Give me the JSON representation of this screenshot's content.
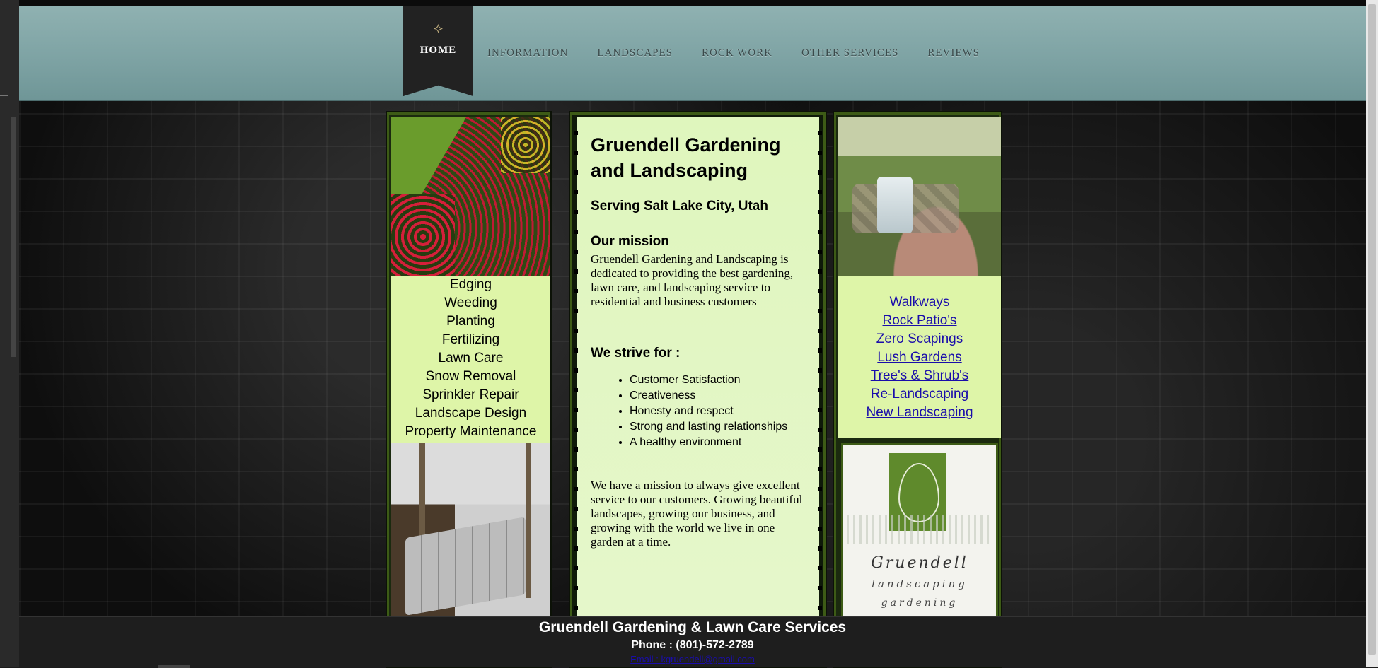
{
  "nav": {
    "flourish": "⟡",
    "items": [
      "HOME",
      "INFORMATION",
      "LANDSCAPES",
      "ROCK WORK",
      "OTHER SERVICES",
      "REVIEWS"
    ]
  },
  "left_column": {
    "services": [
      "Edging",
      "Weeding",
      "Planting",
      "Fertilizing",
      "Lawn Care",
      "Snow Removal",
      "Sprinkler Repair",
      "Landscape Design",
      "Property Maintenance"
    ]
  },
  "main": {
    "title": "Gruendell Gardening and Landscaping",
    "subtitle": "Serving Salt Lake City, Utah",
    "mission_heading": "Our mission",
    "mission_text": "Gruendell Gardening and Landscaping is dedicated to providing the best gardening, lawn care, and landscaping service to residential and business customers",
    "strive_heading": "We strive for :",
    "strive_items": [
      "Customer Satisfaction",
      "Creativeness",
      "Honesty and respect",
      "Strong and lasting relationships",
      "A healthy environment"
    ],
    "closing_text": "We have a mission to always give excellent service to our customers. Growing beautiful landscapes, growing our business, and growing with the world we live in one garden at a time."
  },
  "right_column": {
    "links": [
      "Walkways",
      "Rock Patio's",
      "Zero Scapings",
      "Lush Gardens",
      "Tree's & Shrub's",
      "Re-Landscaping",
      "New Landscaping"
    ],
    "logo_lines": [
      "Gruendell",
      "landscaping",
      "gardening"
    ]
  },
  "footer": {
    "company": "Gruendell Gardening & Lawn Care Services",
    "phone": "Phone : (801)-572-2789",
    "email": "Email : kgruendell@gmail.com"
  }
}
